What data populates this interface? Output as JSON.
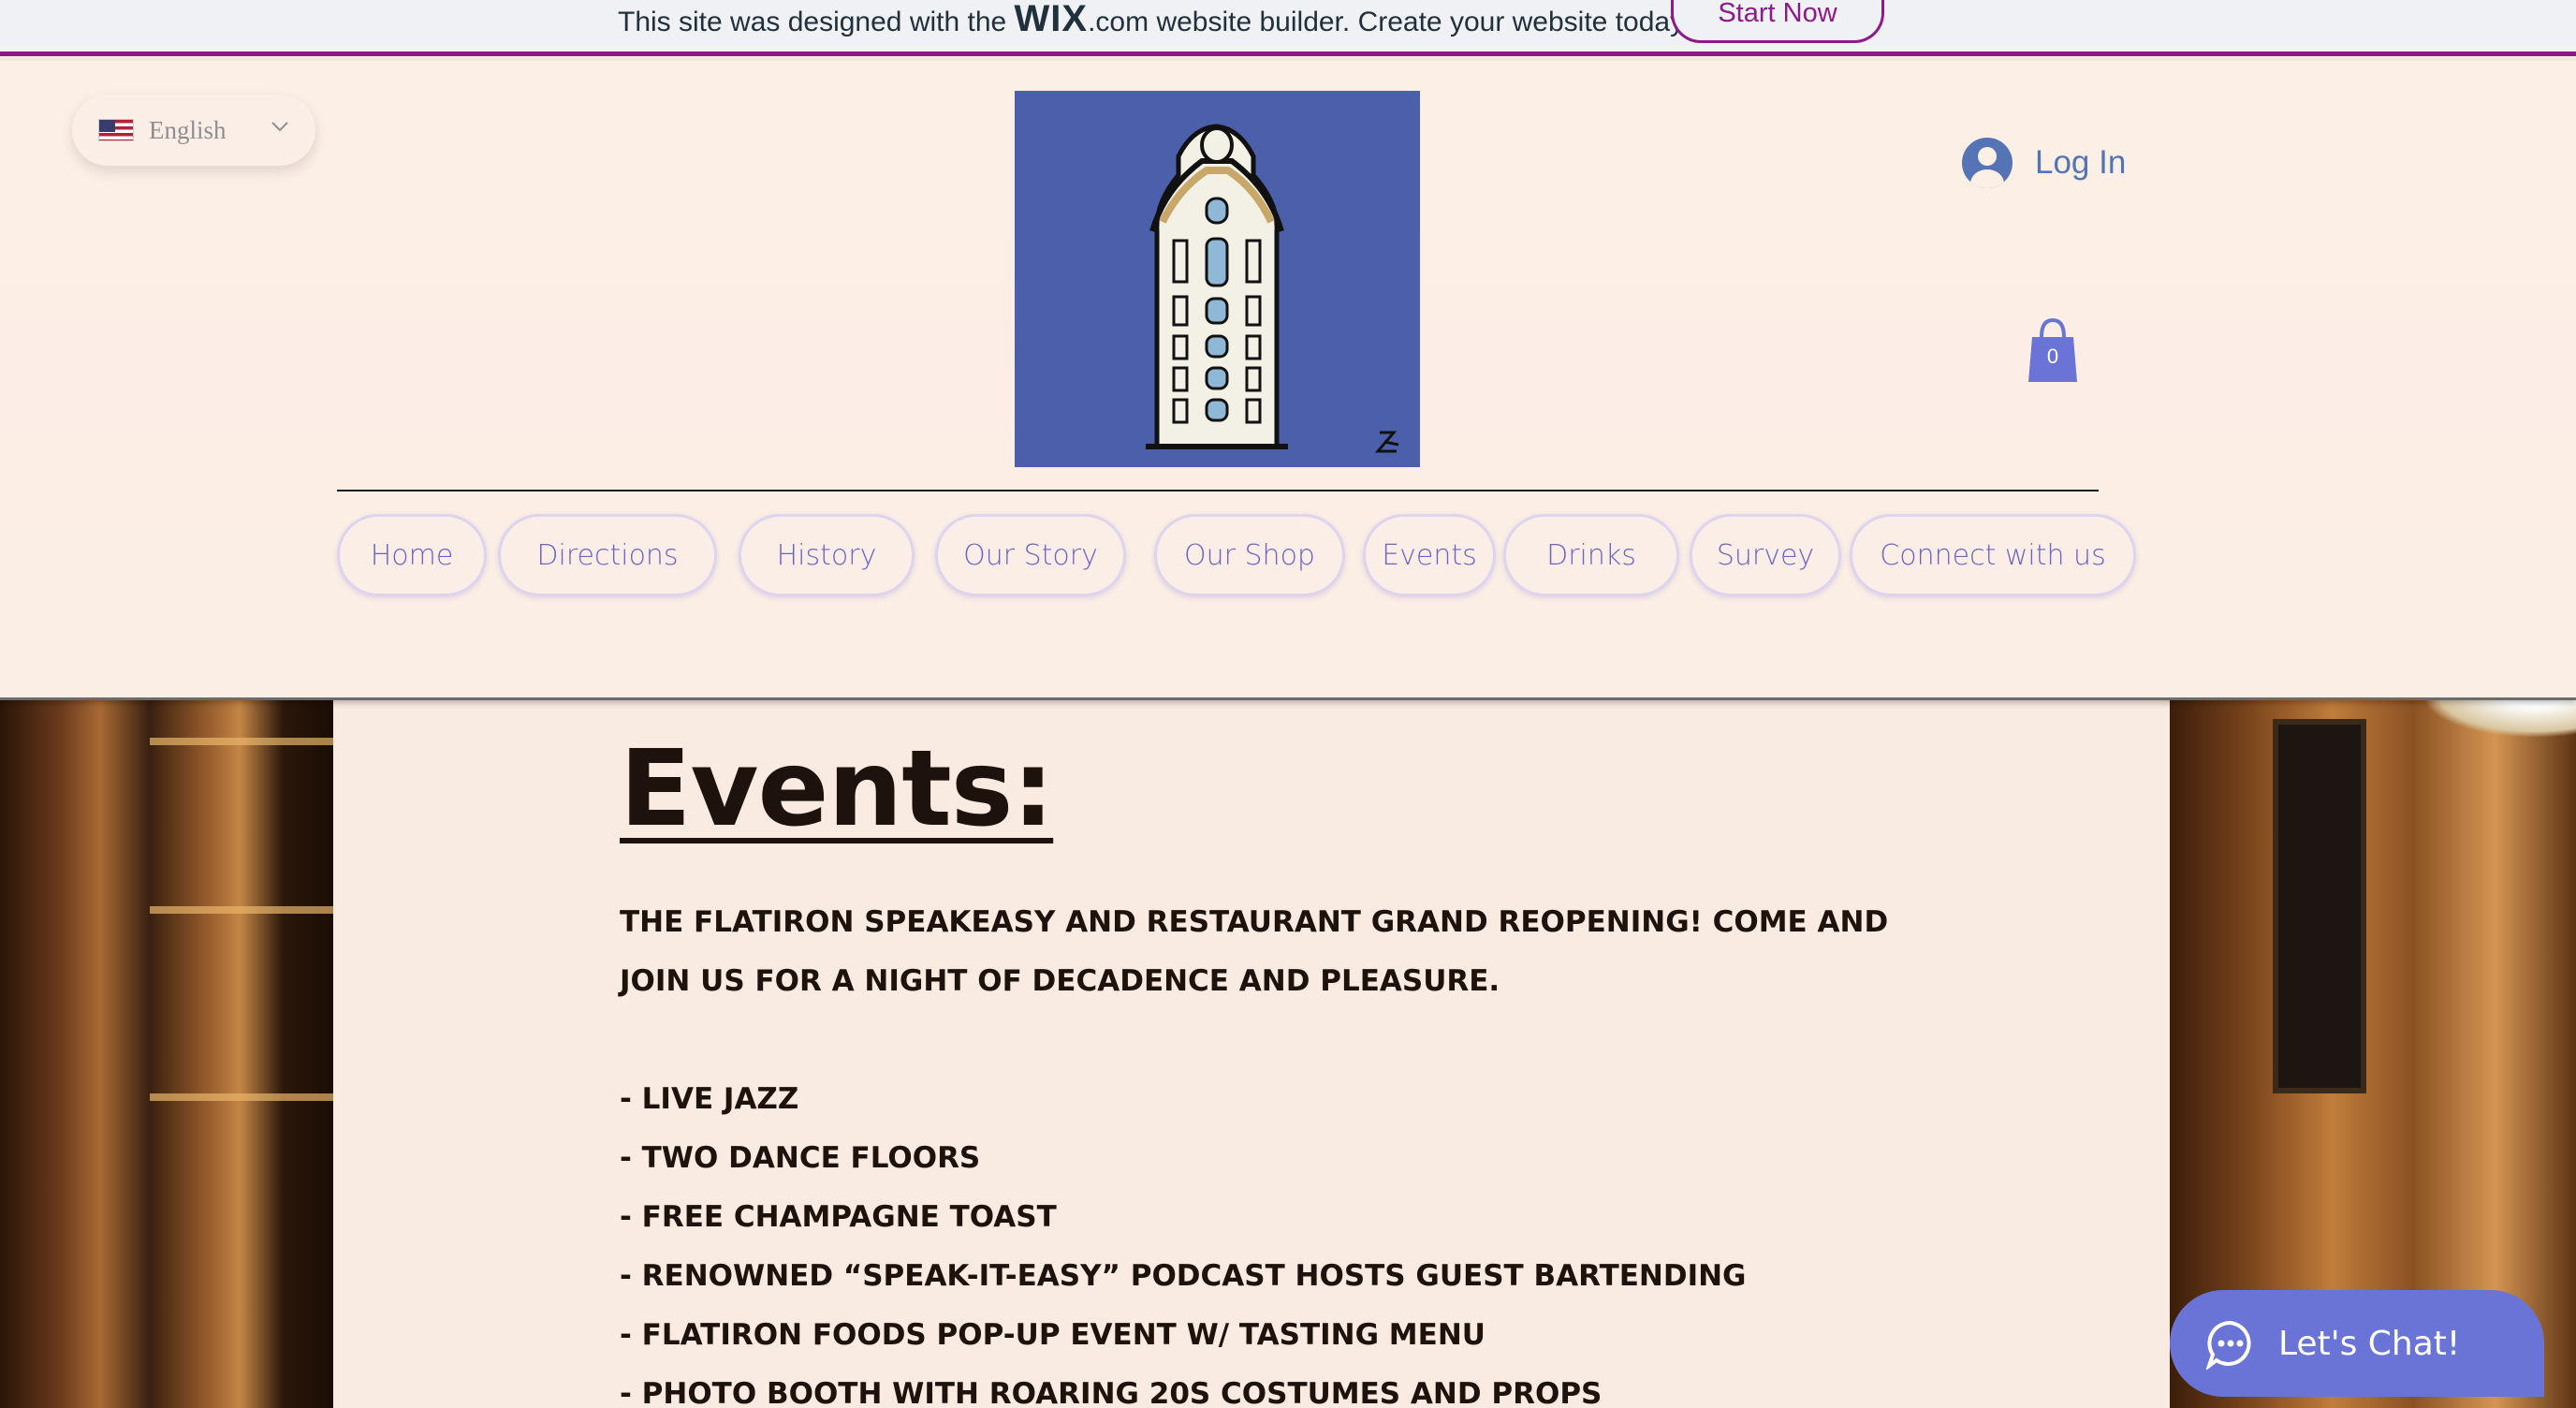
{
  "banner": {
    "text_before": "This site was designed with the ",
    "wix": "WIX",
    "text_after": ".com website builder. Create your website today.",
    "cta": "Start Now"
  },
  "header": {
    "language": "English",
    "login": "Log In",
    "cart_count": "0"
  },
  "nav": {
    "items": [
      "Home",
      "Directions",
      "History",
      "Our Story",
      "Our Shop",
      "Events",
      "Drinks",
      "Survey",
      "Connect with us"
    ]
  },
  "main": {
    "title": "Events:",
    "intro_line1": "THE FLATIRON SPEAKEASY AND RESTAURANT GRAND REOPENING! COME AND",
    "intro_line2": "JOIN US FOR A NIGHT OF DECADENCE AND PLEASURE.",
    "list": [
      "- LIVE JAZZ",
      "- TWO DANCE FLOORS",
      "- FREE CHAMPAGNE TOAST",
      "- RENOWNED “SPEAK-IT-EASY” PODCAST HOSTS GUEST BARTENDING",
      "- FLATIRON FOODS POP-UP EVENT W/ TASTING MENU",
      "- PHOTO BOOTH WITH ROARING 20S COSTUMES AND PROPS"
    ]
  },
  "chat": {
    "label": "Let's Chat!"
  },
  "colors": {
    "accent": "#8d1a8a",
    "nav_text": "#6b63c5",
    "login": "#5474b5",
    "chat": "#6a74d6",
    "logo_bg": "#4c5fab"
  },
  "icons": [
    "flag-us-icon",
    "chevron-down-icon",
    "user-avatar-icon",
    "shopping-bag-icon",
    "chat-bubble-icon"
  ]
}
